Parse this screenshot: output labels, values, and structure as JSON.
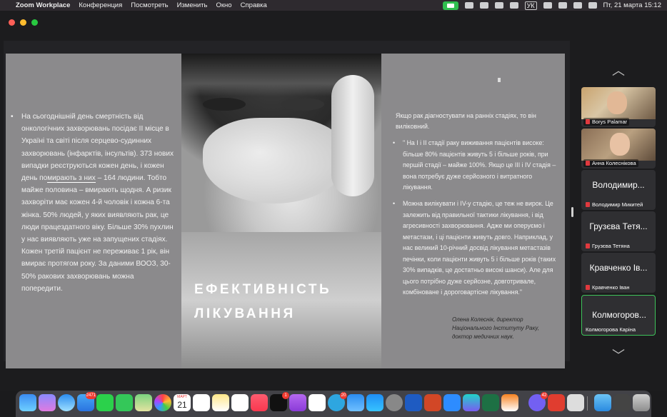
{
  "menubar": {
    "apple_icon": "",
    "app_name": "Zoom Workplace",
    "menus": [
      "Конференция",
      "Посмотреть",
      "Изменить",
      "Окно",
      "Справка"
    ],
    "lang": "УК",
    "datetime": "Пт, 21 марта  15:12"
  },
  "slide": {
    "left_text_1": "На сьогоднішній день смертність від онкологічних захворювань посідає ІІ місце в Україні та світі після серцево-судинних захворювань (інфарктів, інсультів). 373 нових випадки реєструються кожен день, і кожен день по",
    "left_text_underline": "мирають з них",
    "left_text_2": " – 164 людини. Тобто майже половина – вмирають щодня. А ризик захворіти має кожен 4-й чоловік і кожна 6-та жінка. 50% людей, у яких виявляють рак, це люди працездатного віку. Більше 30% пухлин у нас виявляють уже на запущених стадіях. Кожен третій пацієнт не переживає 1 рік, він вмирає протягом року. За даними ВООЗ, 30-50% ракових захворювань можна попередити.",
    "title_line1": "ЕФЕКТИВНІСТЬ",
    "title_line2": "ЛІКУВАННЯ",
    "right_intro": "Якщо рак діагностувати на ранніх стадіях, то він виліковний.",
    "right_bullet_1": "\" На І і ІІ стадії раку виживання пацієнтів високе: більше 80% пацієнтів живуть 5 і більше років, при першій стадії – майже 100%. Якщо це ІІІ і IV стадія – вона потребує дуже серйозного і витратного лікування.",
    "right_bullet_2": "Можна вилікувати і IV-у стадію, це теж не вирок. Це залежить від правильної тактики лікування, і від агресивності захворювання. Адже ми оперуємо і метастази, і ці пацієнти живуть довго. Наприклад, у нас великий 10-річний досвід лікування метастазів печінки, коли пацієнти живуть 5 і більше років (таких 30% випадків, це достатньо високі шанси). Але для цього потрібно дуже серйозне, довготривале, комбіноване і дороговартісне лікування.\"",
    "author": "Олена Колеснік, директор Національного Інституту Раку, доктор медичних наук."
  },
  "participants": [
    {
      "display": "",
      "name": "Borys Palamar",
      "video": true
    },
    {
      "display": "",
      "name": "Анна Колеснікова",
      "video": true
    },
    {
      "display": "Володимир...",
      "name": "Володимир Микитей",
      "video": false
    },
    {
      "display": "Грузєва Тетя...",
      "name": "Грузєва Тетяна",
      "video": false
    },
    {
      "display": "Кравченко Ів...",
      "name": "Кравченко Іван",
      "video": false
    },
    {
      "display": "Колмогоров...",
      "name": "Колмогорова Каріна",
      "video": false
    }
  ],
  "dock": {
    "badges": {
      "mail": "2471",
      "tv": "1",
      "telegram": "20",
      "viber": "42"
    },
    "calendar_month": "МАРТ",
    "calendar_day": "21"
  },
  "colors": {
    "active_speaker": "#3ec35a",
    "slide_bg": "#8b8a8c",
    "mute": "#e0393e"
  }
}
